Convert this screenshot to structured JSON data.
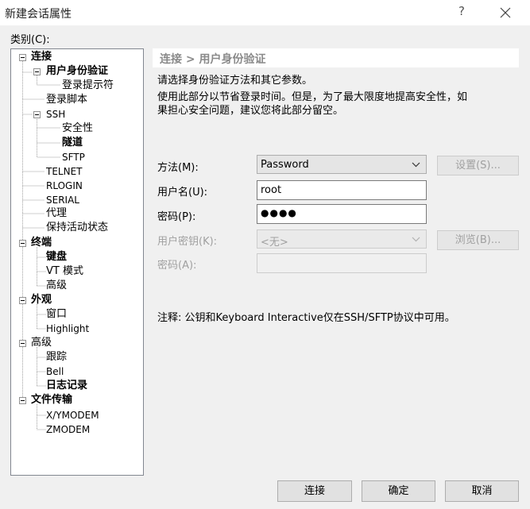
{
  "window": {
    "title": "新建会话属性",
    "help": "?"
  },
  "category_label": "类别(C):",
  "tree": [
    {
      "label": "连接",
      "bold": true
    },
    {
      "label": "用户身份验证",
      "bold": true
    },
    {
      "label": "登录提示符"
    },
    {
      "label": "登录脚本"
    },
    {
      "label": "SSH",
      "small": true
    },
    {
      "label": "安全性"
    },
    {
      "label": "隧道",
      "bold": true
    },
    {
      "label": "SFTP",
      "small": true
    },
    {
      "label": "TELNET",
      "small": true
    },
    {
      "label": "RLOGIN",
      "small": true
    },
    {
      "label": "SERIAL",
      "small": true
    },
    {
      "label": "代理"
    },
    {
      "label": "保持活动状态"
    },
    {
      "label": "终端",
      "bold": true
    },
    {
      "label": "键盘",
      "bold": true
    },
    {
      "label": "VT 模式"
    },
    {
      "label": "高级"
    },
    {
      "label": "外观",
      "bold": true
    },
    {
      "label": "窗口"
    },
    {
      "label": "Highlight",
      "small": true
    },
    {
      "label": "高级"
    },
    {
      "label": "跟踪"
    },
    {
      "label": "Bell",
      "small": true
    },
    {
      "label": "日志记录",
      "bold": true
    },
    {
      "label": "文件传输",
      "bold": true
    },
    {
      "label": "X/YMODEM",
      "small": true
    },
    {
      "label": "ZMODEM",
      "small": true
    }
  ],
  "header": "连接 > 用户身份验证",
  "description": {
    "line1": "请选择身份验证方法和其它参数。",
    "line2": "使用此部分以节省登录时间。但是，为了最大限度地提高安全性，如",
    "line3": "果担心安全问题，建议您将此部分留空。"
  },
  "form": {
    "method_label": "方法(M):",
    "method_value": "Password",
    "settings_button": "设置(S)...",
    "username_label": "用户名(U):",
    "username_value": "root",
    "password_label": "密码(P):",
    "password_value": "●●●●",
    "user_key_label": "用户密钥(K):",
    "user_key_value": "<无>",
    "browse_button": "浏览(B)...",
    "passphrase_label": "密码(A):"
  },
  "note": "注释: 公钥和Keyboard Interactive仅在SSH/SFTP协议中可用。",
  "buttons": {
    "connect": "连接",
    "ok": "确定",
    "cancel": "取消"
  }
}
